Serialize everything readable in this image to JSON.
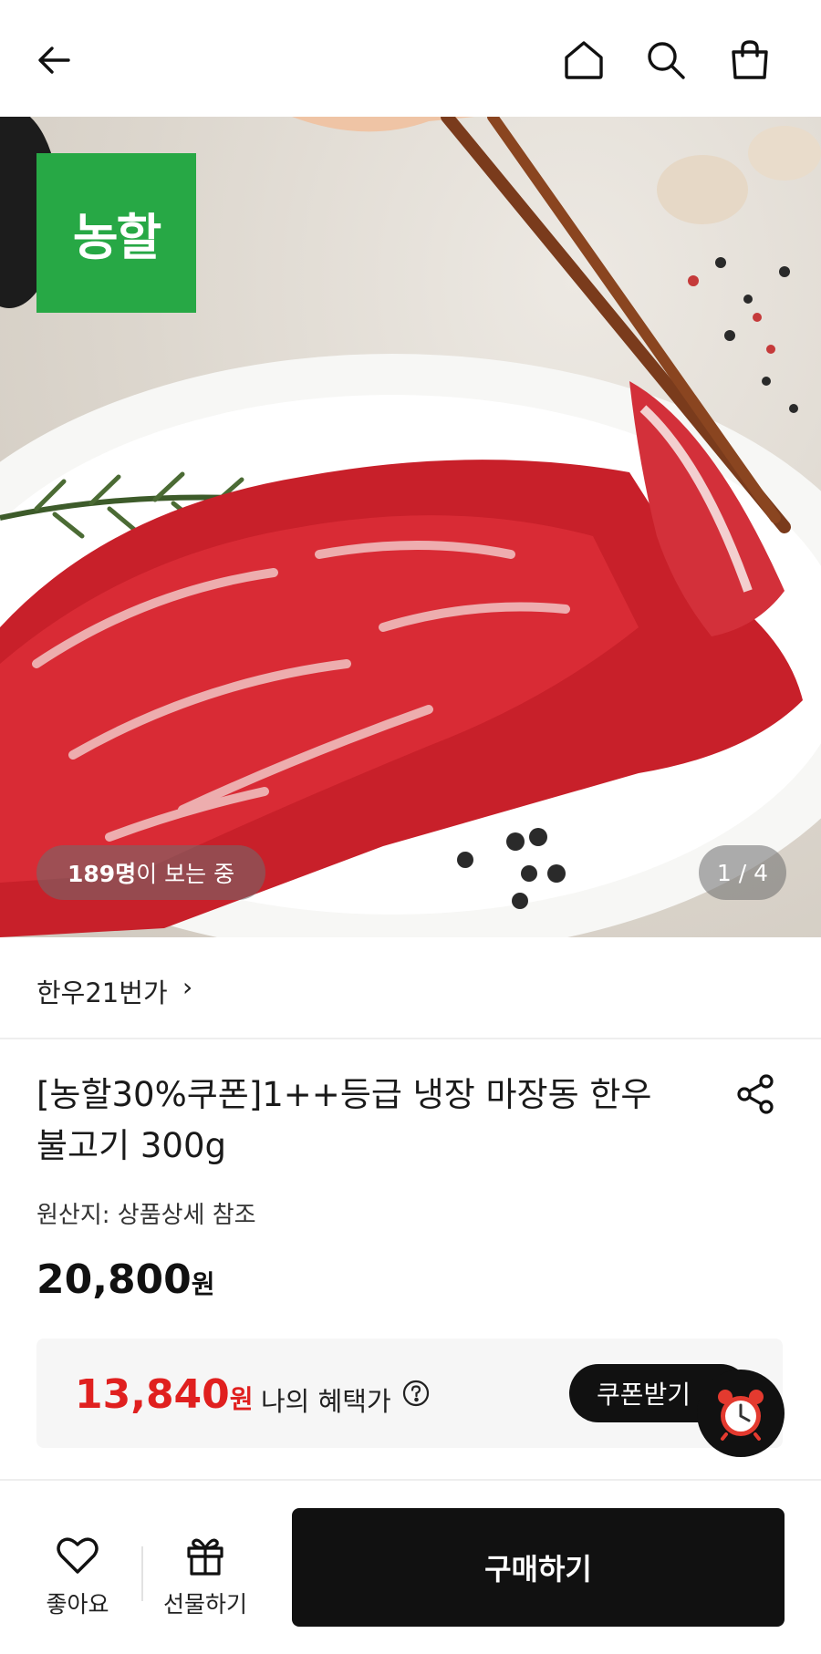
{
  "header": {
    "back_icon": "arrow-left-icon",
    "home_icon": "home-icon",
    "search_icon": "search-icon",
    "cart_icon": "shopping-bag-icon"
  },
  "hero": {
    "logo_text": "농할",
    "viewers_count": "189명",
    "viewers_suffix": "이 보는 중",
    "pager": "1 / 4",
    "colors": {
      "logo_bg": "#27a845"
    }
  },
  "store": {
    "name": "한우21번가",
    "chevron": "›"
  },
  "product": {
    "title": "[농할30%쿠폰]1++등급 냉장 마장동 한우 불고기 300g",
    "origin": "원산지: 상품상세 참조",
    "price_value": "20,800",
    "price_unit": "원"
  },
  "benefit": {
    "price_value": "13,840",
    "price_unit": "원",
    "label": "나의 혜택가",
    "coupon_label": "쿠폰받기",
    "colors": {
      "price": "#e0201f"
    }
  },
  "bottom_bar": {
    "like_label": "좋아요",
    "gift_label": "선물하기",
    "buy_label": "구매하기"
  }
}
